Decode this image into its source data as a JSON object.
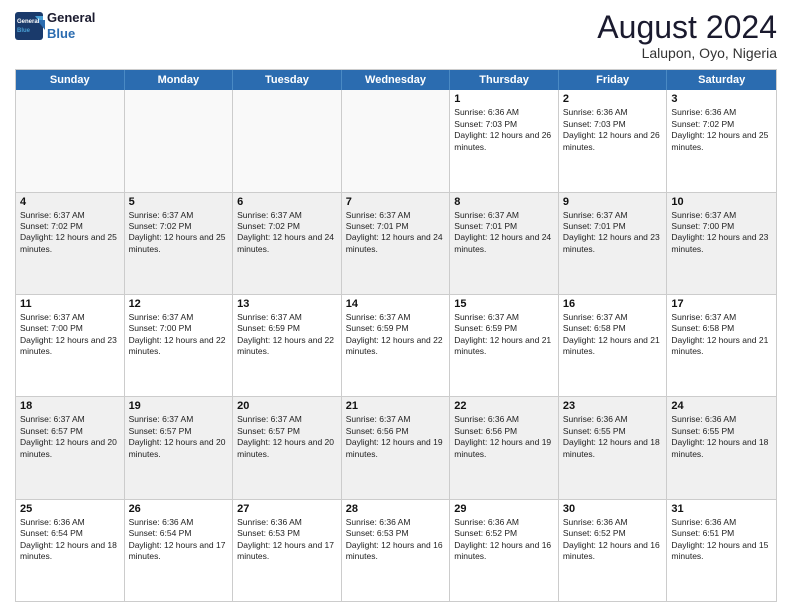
{
  "header": {
    "logo_line1": "General",
    "logo_line2": "Blue",
    "month_title": "August 2024",
    "location": "Lalupon, Oyo, Nigeria"
  },
  "days_of_week": [
    "Sunday",
    "Monday",
    "Tuesday",
    "Wednesday",
    "Thursday",
    "Friday",
    "Saturday"
  ],
  "weeks": [
    [
      {
        "day": "",
        "empty": true
      },
      {
        "day": "",
        "empty": true
      },
      {
        "day": "",
        "empty": true
      },
      {
        "day": "",
        "empty": true
      },
      {
        "day": "1",
        "sunrise": "6:36 AM",
        "sunset": "7:03 PM",
        "daylight": "12 hours and 26 minutes."
      },
      {
        "day": "2",
        "sunrise": "6:36 AM",
        "sunset": "7:03 PM",
        "daylight": "12 hours and 26 minutes."
      },
      {
        "day": "3",
        "sunrise": "6:36 AM",
        "sunset": "7:02 PM",
        "daylight": "12 hours and 25 minutes."
      }
    ],
    [
      {
        "day": "4",
        "sunrise": "6:37 AM",
        "sunset": "7:02 PM",
        "daylight": "12 hours and 25 minutes."
      },
      {
        "day": "5",
        "sunrise": "6:37 AM",
        "sunset": "7:02 PM",
        "daylight": "12 hours and 25 minutes."
      },
      {
        "day": "6",
        "sunrise": "6:37 AM",
        "sunset": "7:02 PM",
        "daylight": "12 hours and 24 minutes."
      },
      {
        "day": "7",
        "sunrise": "6:37 AM",
        "sunset": "7:01 PM",
        "daylight": "12 hours and 24 minutes."
      },
      {
        "day": "8",
        "sunrise": "6:37 AM",
        "sunset": "7:01 PM",
        "daylight": "12 hours and 24 minutes."
      },
      {
        "day": "9",
        "sunrise": "6:37 AM",
        "sunset": "7:01 PM",
        "daylight": "12 hours and 23 minutes."
      },
      {
        "day": "10",
        "sunrise": "6:37 AM",
        "sunset": "7:00 PM",
        "daylight": "12 hours and 23 minutes."
      }
    ],
    [
      {
        "day": "11",
        "sunrise": "6:37 AM",
        "sunset": "7:00 PM",
        "daylight": "12 hours and 23 minutes."
      },
      {
        "day": "12",
        "sunrise": "6:37 AM",
        "sunset": "7:00 PM",
        "daylight": "12 hours and 22 minutes."
      },
      {
        "day": "13",
        "sunrise": "6:37 AM",
        "sunset": "6:59 PM",
        "daylight": "12 hours and 22 minutes."
      },
      {
        "day": "14",
        "sunrise": "6:37 AM",
        "sunset": "6:59 PM",
        "daylight": "12 hours and 22 minutes."
      },
      {
        "day": "15",
        "sunrise": "6:37 AM",
        "sunset": "6:59 PM",
        "daylight": "12 hours and 21 minutes."
      },
      {
        "day": "16",
        "sunrise": "6:37 AM",
        "sunset": "6:58 PM",
        "daylight": "12 hours and 21 minutes."
      },
      {
        "day": "17",
        "sunrise": "6:37 AM",
        "sunset": "6:58 PM",
        "daylight": "12 hours and 21 minutes."
      }
    ],
    [
      {
        "day": "18",
        "sunrise": "6:37 AM",
        "sunset": "6:57 PM",
        "daylight": "12 hours and 20 minutes."
      },
      {
        "day": "19",
        "sunrise": "6:37 AM",
        "sunset": "6:57 PM",
        "daylight": "12 hours and 20 minutes."
      },
      {
        "day": "20",
        "sunrise": "6:37 AM",
        "sunset": "6:57 PM",
        "daylight": "12 hours and 20 minutes."
      },
      {
        "day": "21",
        "sunrise": "6:37 AM",
        "sunset": "6:56 PM",
        "daylight": "12 hours and 19 minutes."
      },
      {
        "day": "22",
        "sunrise": "6:36 AM",
        "sunset": "6:56 PM",
        "daylight": "12 hours and 19 minutes."
      },
      {
        "day": "23",
        "sunrise": "6:36 AM",
        "sunset": "6:55 PM",
        "daylight": "12 hours and 18 minutes."
      },
      {
        "day": "24",
        "sunrise": "6:36 AM",
        "sunset": "6:55 PM",
        "daylight": "12 hours and 18 minutes."
      }
    ],
    [
      {
        "day": "25",
        "sunrise": "6:36 AM",
        "sunset": "6:54 PM",
        "daylight": "12 hours and 18 minutes."
      },
      {
        "day": "26",
        "sunrise": "6:36 AM",
        "sunset": "6:54 PM",
        "daylight": "12 hours and 17 minutes."
      },
      {
        "day": "27",
        "sunrise": "6:36 AM",
        "sunset": "6:53 PM",
        "daylight": "12 hours and 17 minutes."
      },
      {
        "day": "28",
        "sunrise": "6:36 AM",
        "sunset": "6:53 PM",
        "daylight": "12 hours and 16 minutes."
      },
      {
        "day": "29",
        "sunrise": "6:36 AM",
        "sunset": "6:52 PM",
        "daylight": "12 hours and 16 minutes."
      },
      {
        "day": "30",
        "sunrise": "6:36 AM",
        "sunset": "6:52 PM",
        "daylight": "12 hours and 16 minutes."
      },
      {
        "day": "31",
        "sunrise": "6:36 AM",
        "sunset": "6:51 PM",
        "daylight": "12 hours and 15 minutes."
      }
    ]
  ]
}
